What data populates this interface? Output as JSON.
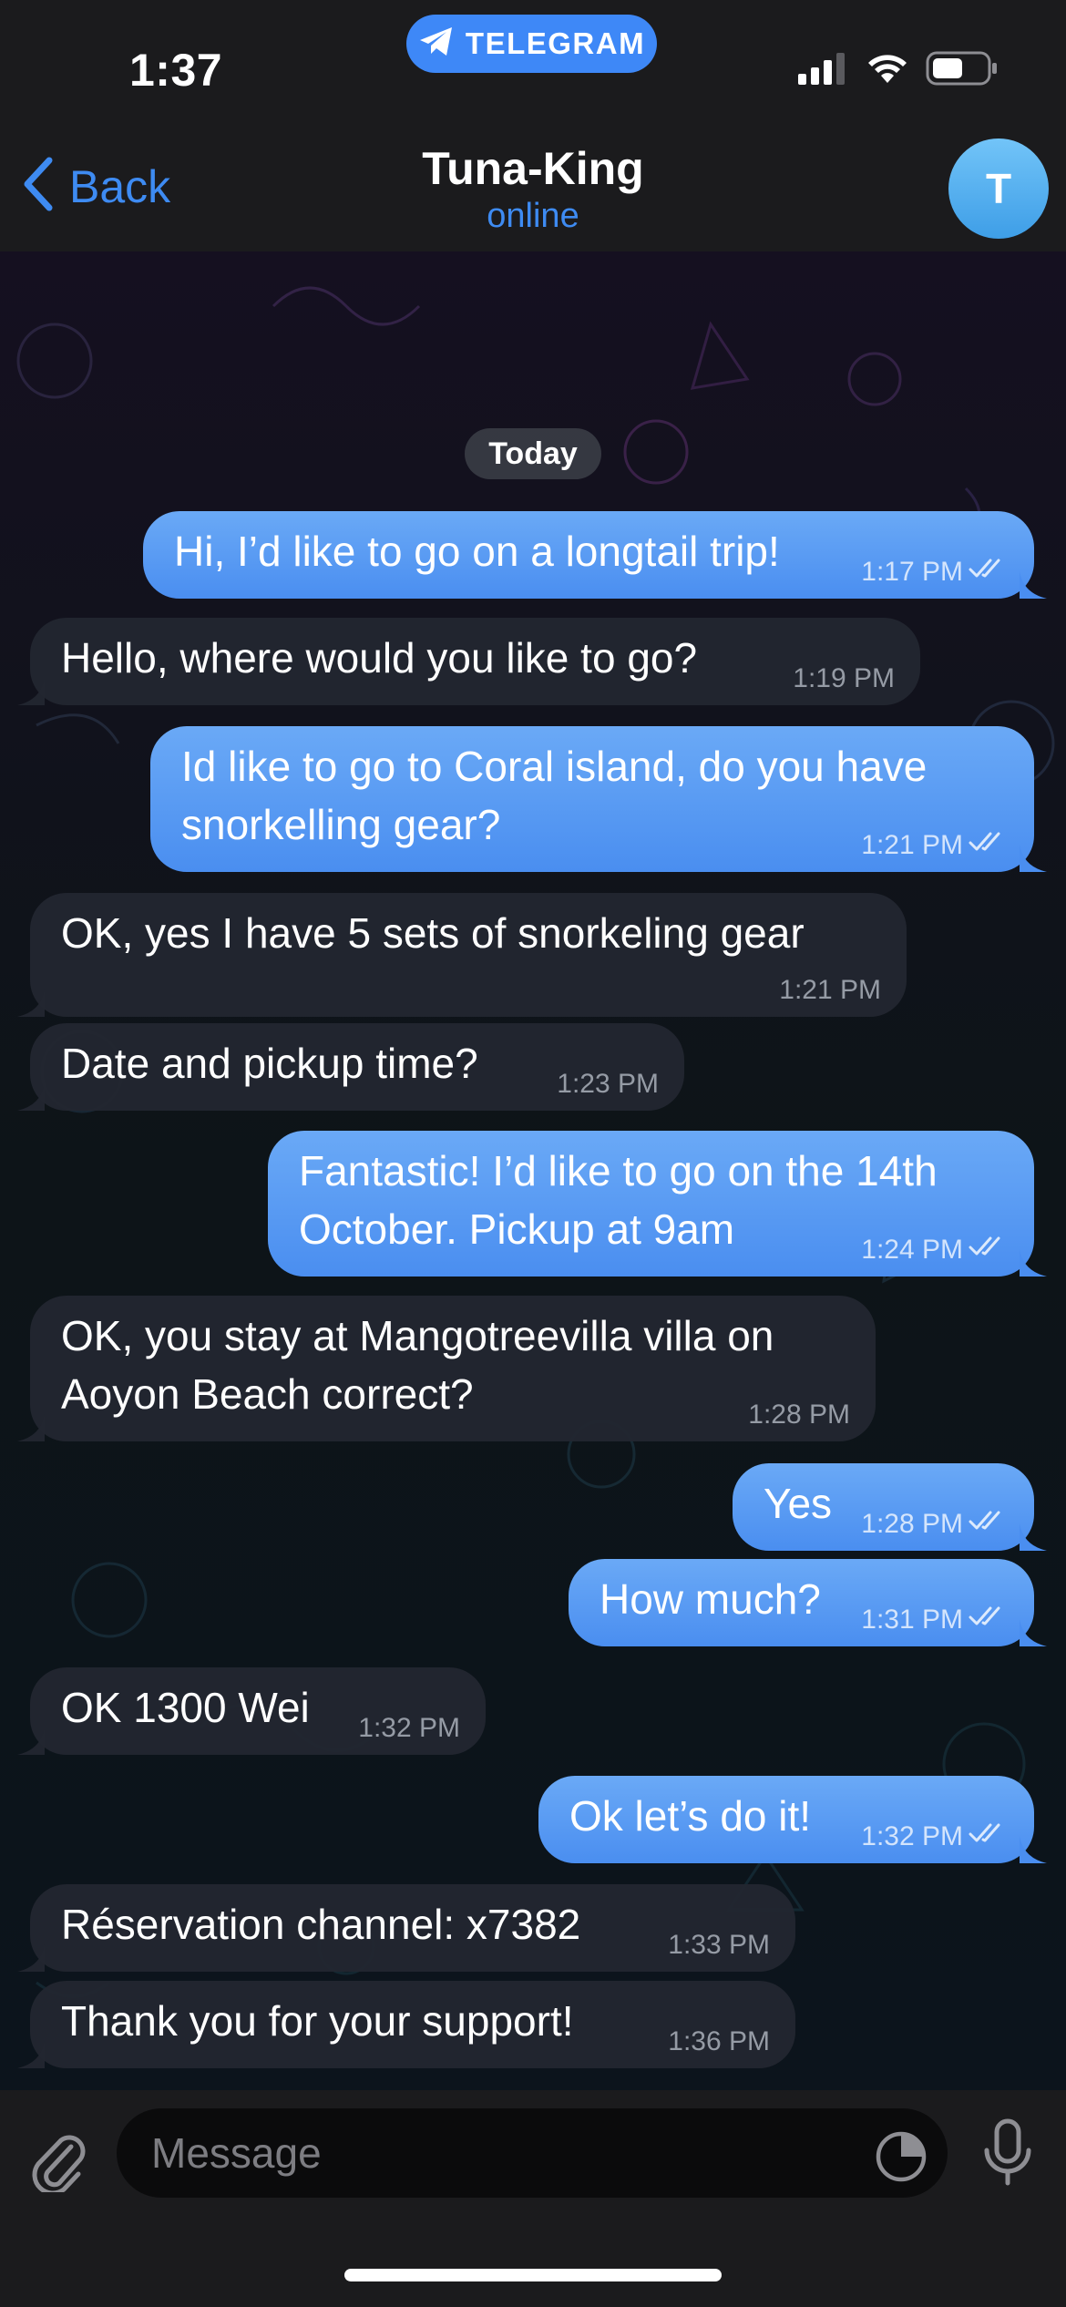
{
  "status_bar": {
    "time": "1:37",
    "app_pill": "TELEGRAM"
  },
  "nav": {
    "back_label": "Back",
    "title": "Tuna-King",
    "status": "online",
    "avatar_initial": "T"
  },
  "chat": {
    "date_label": "Today",
    "messages": [
      {
        "dir": "out",
        "text": "Hi, I’d like to go on a longtail trip!",
        "time": "1:17 PM"
      },
      {
        "dir": "in",
        "text": "Hello, where would you like to go?",
        "time": "1:19 PM"
      },
      {
        "dir": "out",
        "text": "Id like to go to Coral island, do you have\nsnorkelling gear?",
        "time": "1:21 PM"
      },
      {
        "dir": "in",
        "text": "OK, yes I have 5 sets of snorkeling gear",
        "time": "1:21 PM"
      },
      {
        "dir": "in",
        "text": "Date and pickup time?",
        "time": "1:23 PM"
      },
      {
        "dir": "out",
        "text": "Fantastic! I’d like to go on the 14th\nOctober. Pickup at 9am",
        "time": "1:24 PM"
      },
      {
        "dir": "in",
        "text": "OK, you stay at Mangotreevilla villa on\nAoyon Beach correct?",
        "time": "1:28 PM"
      },
      {
        "dir": "out",
        "text": "Yes",
        "time": "1:28 PM"
      },
      {
        "dir": "out",
        "text": "How much?",
        "time": "1:31 PM"
      },
      {
        "dir": "in",
        "text": "OK 1300 Wei",
        "time": "1:32 PM"
      },
      {
        "dir": "out",
        "text": "Ok let’s do it!",
        "time": "1:32 PM"
      },
      {
        "dir": "in",
        "text": "Réservation channel: x7382",
        "time": "1:33 PM"
      },
      {
        "dir": "in",
        "text": "Thank you for your support!",
        "time": "1:36 PM"
      }
    ]
  },
  "input": {
    "placeholder": "Message"
  },
  "colors": {
    "accent": "#3e8bf2",
    "outgoing_bubble": "#5a9cf4",
    "incoming_bubble": "#222630",
    "bar_background": "#1b1b1d"
  }
}
